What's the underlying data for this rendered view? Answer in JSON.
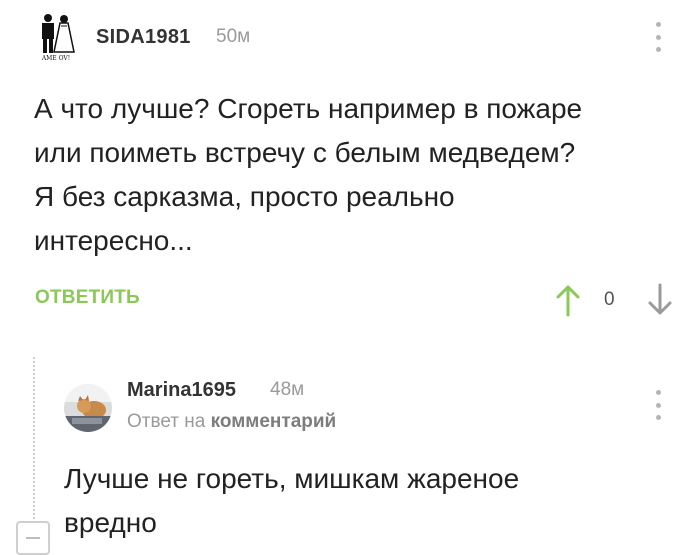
{
  "comment1": {
    "username": "SIDA1981",
    "time": "50м",
    "avatar_caption": "AME OV!",
    "text_lines": [
      "А что лучше? Сгореть например в пожаре",
      "или поиметь встречу с белым медведем?",
      "Я без сарказма, просто реально",
      "интересно..."
    ],
    "reply_label": "ОТВЕТИТЬ",
    "score": "0"
  },
  "comment2": {
    "username": "Marina1695",
    "time": "48м",
    "reply_prefix": "Ответ на",
    "reply_target": "комментарий",
    "text_lines": [
      "Лучше не гореть, мишкам жареное",
      "вредно"
    ]
  },
  "icons": {
    "more": "more-vertical-icon",
    "upvote": "arrow-up-icon",
    "downvote": "arrow-down-icon",
    "collapse": "collapse-thread-icon"
  },
  "colors": {
    "accent_green": "#8ac858",
    "muted_text": "#9a9a9a",
    "icon_gray": "#b5b5b5"
  }
}
